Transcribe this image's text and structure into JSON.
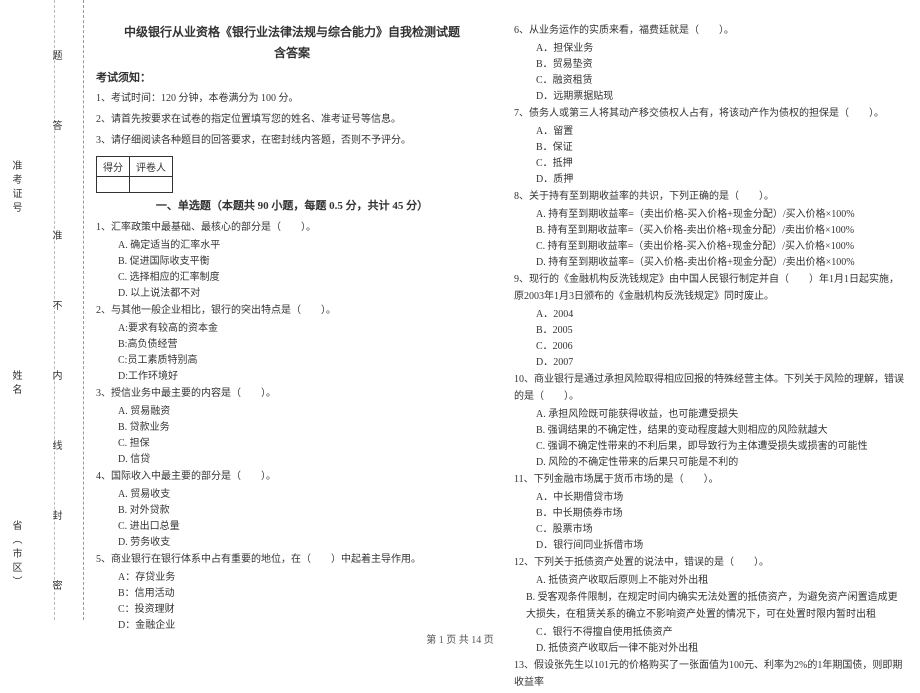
{
  "binding": {
    "province": "省（市区）",
    "name_label": "姓名",
    "admission_label": "准考证号",
    "marks": [
      "密",
      "封",
      "线",
      "内",
      "不",
      "准",
      "答",
      "题"
    ]
  },
  "header": {
    "title": "中级银行从业资格《银行业法律法规与综合能力》自我检测试题",
    "subtitle": "含答案"
  },
  "notice": {
    "heading": "考试须知：",
    "n1": "1、考试时间：120 分钟，本卷满分为 100 分。",
    "n2": "2、请首先按要求在试卷的指定位置填写您的姓名、准考证号等信息。",
    "n3": "3、请仔细阅读各种题目的回答要求，在密封线内答题，否则不予评分。"
  },
  "score": {
    "c1": "得分",
    "c2": "评卷人"
  },
  "part1_title": "一、单选题（本题共 90 小题，每题 0.5 分，共计 45 分）",
  "q1": {
    "stem": "1、汇率政策中最基础、最核心的部分是（　　）。",
    "A": "A. 确定适当的汇率水平",
    "B": "B. 促进国际收支平衡",
    "C": "C. 选择相应的汇率制度",
    "D": "D. 以上说法都不对"
  },
  "q2": {
    "stem": "2、与其他一般企业相比，银行的突出特点是（　　）。",
    "A": "A:要求有较高的资本金",
    "B": "B:高负债经营",
    "C": "C:员工素质特别高",
    "D": "D:工作环境好"
  },
  "q3": {
    "stem": "3、授信业务中最主要的内容是（　　）。",
    "A": "A. 贸易融资",
    "B": "B. 贷款业务",
    "C": "C. 担保",
    "D": "D. 信贷"
  },
  "q4": {
    "stem": "4、国际收入中最主要的部分是（　　）。",
    "A": "A. 贸易收支",
    "B": "B. 对外贷款",
    "C": "C. 进出口总量",
    "D": "D. 劳务收支"
  },
  "q5": {
    "stem": "5、商业银行在银行体系中占有重要的地位，在（　　）中起着主导作用。",
    "A": "A：存贷业务",
    "B": "B：信用活动",
    "C": "C：投资理财",
    "D": "D：金融企业"
  },
  "q6": {
    "stem": "6、从业务运作的实质来看，福费廷就是（　　）。",
    "A": "A．担保业务",
    "B": "B．贸易垫资",
    "C": "C．融资租赁",
    "D": "D．远期票据贴现"
  },
  "q7": {
    "stem": "7、债务人或第三人将其动产移交债权人占有，将该动产作为债权的担保是（　　）。",
    "A": "A．留置",
    "B": "B．保证",
    "C": "C．抵押",
    "D": "D．质押"
  },
  "q8": {
    "stem": "8、关于持有至到期收益率的共识，下列正确的是（　　）。",
    "A": "A. 持有至到期收益率=（卖出价格-买入价格+现金分配）/买入价格×100%",
    "B": "B. 持有至到期收益率=（买入价格-卖出价格+现金分配）/卖出价格×100%",
    "C": "C. 持有至到期收益率=（卖出价格-买入价格+现金分配）/买入价格×100%",
    "D": "D. 持有至到期收益率=（买入价格-卖出价格+现金分配）/卖出价格×100%"
  },
  "q9": {
    "stem": "9、现行的《金融机构反洗钱规定》由中国人民银行制定并自（　　）年1月1日起实施，原2003年1月3日颁布的《金融机构反洗钱规定》同时废止。",
    "A": "A．2004",
    "B": "B．2005",
    "C": "C．2006",
    "D": "D．2007"
  },
  "q10": {
    "stem": "10、商业银行是通过承担风险取得相应回报的特殊经营主体。下列关于风险的理解，错误的是（　　）。",
    "A": "A. 承担风险既可能获得收益，也可能遭受损失",
    "B": "B. 强调结果的不确定性，结果的变动程度越大则相应的风险就越大",
    "C": "C. 强调不确定性带来的不利后果，即导致行为主体遭受损失或损害的可能性",
    "D": "D. 风险的不确定性带来的后果只可能是不利的"
  },
  "q11": {
    "stem": "11、下列金融市场属于货币市场的是（　　）。",
    "A": "A．中长期借贷市场",
    "B": "B．中长期债券市场",
    "C": "C．股票市场",
    "D": "D．银行间同业拆借市场"
  },
  "q12": {
    "stem": "12、下列关于抵债资产处置的说法中，错误的是（　　）。",
    "A": "A. 抵债资产收取后原则上不能对外出租",
    "B": "B. 受客观条件限制，在规定时间内确实无法处置的抵债资产，为避免资产闲置造成更大损失，在租赁关系的确立不影响资产处置的情况下，可在处置时限内暂时出租",
    "C": "C．银行不得擅自使用抵债资产",
    "D": "D. 抵债资产收取后一律不能对外出租"
  },
  "q13": {
    "stem": "13、假设张先生以101元的价格购买了一张面值为100元、利率为2%的1年期国债，则即期收益率"
  },
  "footer": "第 1 页 共 14 页"
}
